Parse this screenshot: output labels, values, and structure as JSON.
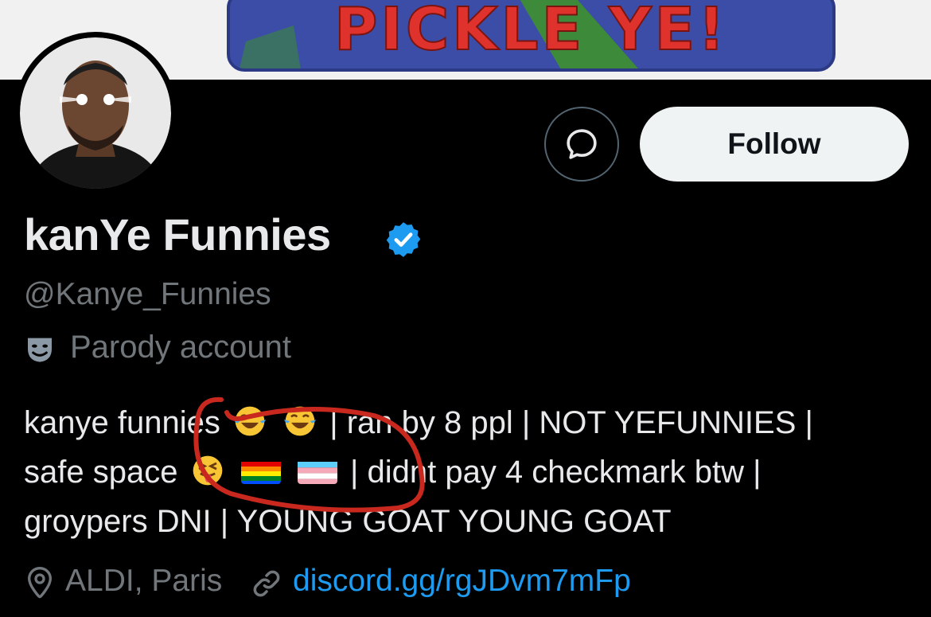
{
  "banner": {
    "text": "PICKLE YE!"
  },
  "profile": {
    "display_name": "kanYe Funnies",
    "handle": "@Kanye_Funnies",
    "parody_label": "Parody account",
    "verified": true
  },
  "actions": {
    "follow_label": "Follow"
  },
  "bio": {
    "line1_a": "kanye funnies",
    "line1_b": "| ran by 8 ppl | NOT YEFUNNIES |",
    "line2_a": "safe space",
    "line2_b": "| didnt pay 4 checkmark btw |",
    "line3": "groypers DNI | YOUNG GOAT YOUNG GOAT"
  },
  "meta": {
    "location": "ALDI, Paris",
    "link": "discord.gg/rgJDvm7mFp"
  },
  "colors": {
    "background": "#000000",
    "text": "#e7e9ea",
    "secondary": "#71767b",
    "link": "#1d9bf0",
    "annotation": "#c8281e"
  }
}
